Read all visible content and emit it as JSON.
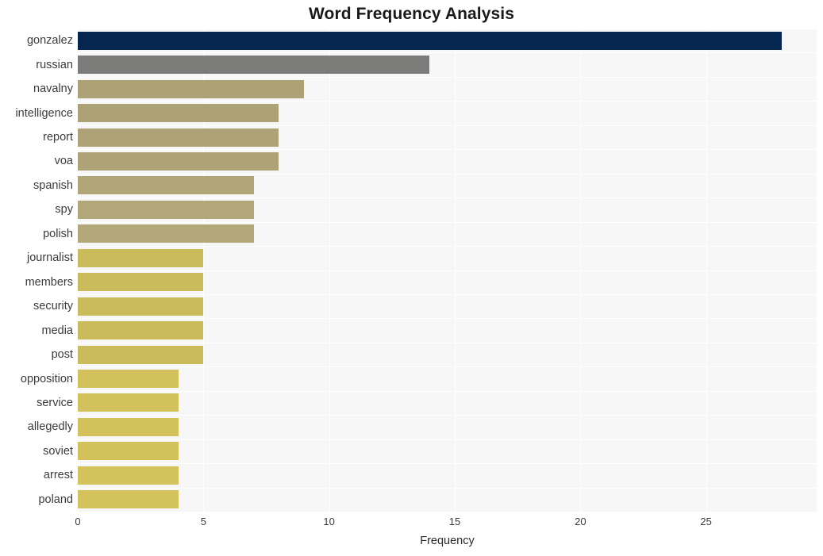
{
  "chart_data": {
    "type": "bar",
    "orientation": "horizontal",
    "title": "Word Frequency Analysis",
    "xlabel": "Frequency",
    "ylabel": "",
    "categories": [
      "gonzalez",
      "russian",
      "navalny",
      "intelligence",
      "report",
      "voa",
      "spanish",
      "spy",
      "polish",
      "journalist",
      "members",
      "security",
      "media",
      "post",
      "opposition",
      "service",
      "allegedly",
      "soviet",
      "arrest",
      "poland"
    ],
    "values": [
      28,
      14,
      9,
      8,
      8,
      8,
      7,
      7,
      7,
      5,
      5,
      5,
      5,
      5,
      4,
      4,
      4,
      4,
      4,
      4
    ],
    "bar_colors": [
      "#04264f",
      "#7b7b79",
      "#aca275",
      "#aca276",
      "#ada377",
      "#ada377",
      "#b0a678",
      "#b1a778",
      "#b2a879",
      "#cbbc5b",
      "#cbbc5b",
      "#cbbc5b",
      "#cbbc5b",
      "#cbbc5b",
      "#d2c15c",
      "#d2c15c",
      "#d3c25c",
      "#d3c25c",
      "#d4c35d",
      "#d4c35d"
    ],
    "xlim": [
      0,
      29.4
    ],
    "xticks": [
      0,
      5,
      10,
      15,
      20,
      25
    ],
    "xtick_labels": [
      "0",
      "5",
      "10",
      "15",
      "20",
      "25"
    ],
    "grid": true,
    "grid_color": "#ffffff",
    "plot_background": "#f7f7f7",
    "figure_background": "#ffffff",
    "legend": null
  }
}
